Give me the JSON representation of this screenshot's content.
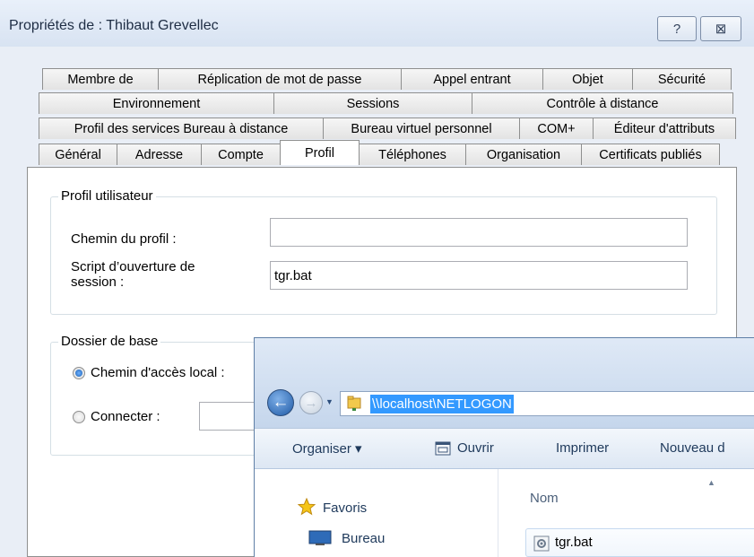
{
  "dialog": {
    "title": "Propriétés de : Thibaut Grevellec",
    "help_label": "?",
    "close_label": "⊠",
    "tabs_row1": [
      "Membre de",
      "Réplication de mot de passe",
      "Appel entrant",
      "Objet",
      "Sécurité"
    ],
    "tabs_row2": [
      "Environnement",
      "Sessions",
      "Contrôle à distance"
    ],
    "tabs_row3": [
      "Profil des services Bureau à distance",
      "Bureau virtuel personnel",
      "COM+",
      "Éditeur d'attributs"
    ],
    "tabs_row4": [
      "Général",
      "Adresse",
      "Compte",
      "Profil",
      "Téléphones",
      "Organisation",
      "Certificats publiés"
    ],
    "active_tab": "Profil",
    "profile_group": {
      "label": "Profil utilisateur",
      "profile_path_label": "Chemin du profil :",
      "profile_path_value": "",
      "logon_script_label_line1": "Script d’ouverture de",
      "logon_script_label_line2": "session :",
      "logon_script_value": "tgr.bat"
    },
    "home_group": {
      "label": "Dossier de base",
      "local_path_label": "Chemin d'accès local :",
      "connect_label": "Connecter :",
      "selected": "local_path"
    }
  },
  "explorer": {
    "address": "\\\\localhost\\NETLOGON",
    "toolbar": {
      "organize": "Organiser ▾",
      "open": "Ouvrir",
      "print": "Imprimer",
      "new": "Nouveau d"
    },
    "nav": {
      "favorites": "Favoris",
      "desktop": "Bureau"
    },
    "columns": {
      "name": "Nom"
    },
    "files": [
      "tgr.bat"
    ]
  }
}
